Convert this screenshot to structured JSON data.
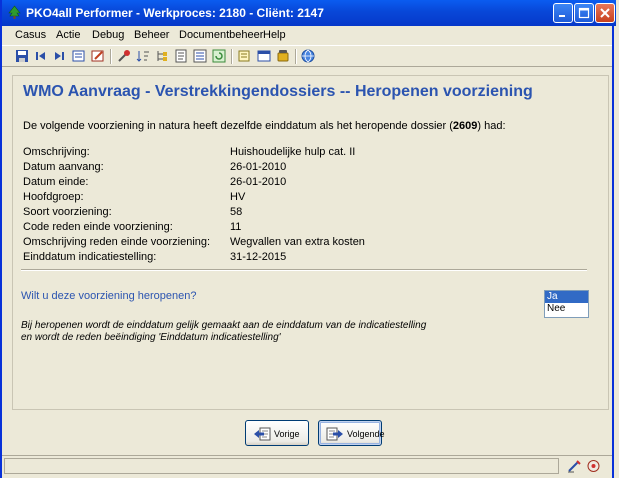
{
  "window": {
    "title": "PKO4all Performer - Werkproces: 2180 - Cliënt: 2147",
    "icon": "tree-icon",
    "controls": [
      "minimize-icon",
      "maximize-icon",
      "close-icon"
    ]
  },
  "menu": {
    "items": [
      "Casus",
      "Actie",
      "Debug",
      "Beheer",
      "Documentbeheer",
      "Help"
    ]
  },
  "toolbar": {
    "icons": [
      "save-icon",
      "first-record-icon",
      "last-record-icon",
      "edit-form-icon",
      "edit-note-icon",
      "tools-icon",
      "sort-icon",
      "tree-view-icon",
      "document-icon",
      "list-icon",
      "refresh-icon",
      "notes-icon",
      "window-icon",
      "phone-icon",
      "globe-icon"
    ]
  },
  "content": {
    "heading": "WMO Aanvraag - Verstrekkingendossiers -- Heropenen voorziening",
    "intro_before": "De volgende voorziening in natura heeft dezelfde einddatum als het heropende dossier (",
    "intro_dossier": "2609",
    "intro_after": ") had:",
    "fields": [
      {
        "label": "Omschrijving:",
        "value": "Huishoudelijke hulp cat. II"
      },
      {
        "label": "Datum aanvang:",
        "value": "26-01-2010"
      },
      {
        "label": "Datum einde:",
        "value": "26-01-2010"
      },
      {
        "label": "Hoofdgroep:",
        "value": "HV"
      },
      {
        "label": "Soort voorziening:",
        "value": "58"
      },
      {
        "label": "Code reden einde voorziening:",
        "value": "11"
      },
      {
        "label": "Omschrijving reden einde voorziening:",
        "value": "Wegvallen van extra kosten"
      },
      {
        "label": "Einddatum indicatiestelling:",
        "value": "31-12-2015"
      }
    ],
    "question": "Wilt u deze voorziening heropenen?",
    "options": [
      "Ja",
      "Nee"
    ],
    "selected_option": "Ja",
    "note_line1": "Bij heropenen wordt de einddatum gelijk gemaakt aan de einddatum van de indicatiestelling",
    "note_line2": "en wordt de reden beëindiging 'Einddatum indicatiestelling'"
  },
  "buttons": {
    "previous": "Vorige",
    "next": "Volgende"
  },
  "colors": {
    "heading": "#2B54B0",
    "titlebar": "#0847D8",
    "selection": "#316AC5"
  }
}
